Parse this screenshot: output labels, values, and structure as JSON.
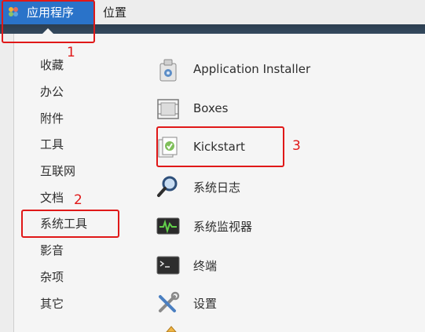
{
  "topbar": {
    "applications_label": "应用程序",
    "places_label": "位置"
  },
  "categories": [
    {
      "label": "收藏"
    },
    {
      "label": "办公"
    },
    {
      "label": "附件"
    },
    {
      "label": "工具"
    },
    {
      "label": "互联网"
    },
    {
      "label": "文档"
    },
    {
      "label": "系统工具"
    },
    {
      "label": "影音"
    },
    {
      "label": "杂项"
    },
    {
      "label": "其它"
    }
  ],
  "apps": [
    {
      "label": "Application Installer",
      "icon": "package-installer-icon"
    },
    {
      "label": "Boxes",
      "icon": "boxes-icon"
    },
    {
      "label": "Kickstart",
      "icon": "kickstart-icon"
    },
    {
      "label": "系统日志",
      "icon": "magnifier-log-icon"
    },
    {
      "label": "系统监视器",
      "icon": "system-monitor-icon"
    },
    {
      "label": "终端",
      "icon": "terminal-icon"
    },
    {
      "label": "设置",
      "icon": "settings-tools-icon"
    }
  ],
  "annotations": [
    "1",
    "2",
    "3"
  ],
  "colors": {
    "accent": "#2a73c9",
    "annotation": "#e01818"
  }
}
